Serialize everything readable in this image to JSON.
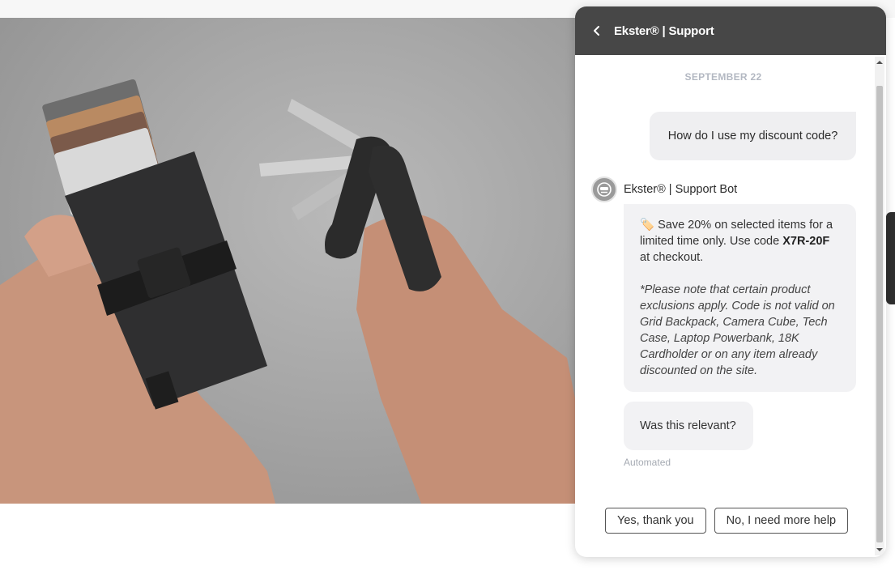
{
  "chat": {
    "title": "Ekster® | Support",
    "date": "SEPTEMBER 22",
    "user_message": "How do I use my discount code?",
    "bot_name": "Ekster® | Support Bot",
    "bot_message": {
      "emoji": "🏷️",
      "line_before_code": "Save 20% on selected items for a limited time only. Use code ",
      "code": "X7R-20F",
      "line_after_code": " at checkout.",
      "note": "*Please note that certain product exclusions apply. Code is not valid on Grid Backpack, Camera Cube, Tech Case, Laptop Powerbank, 18K Cardholder or on any item already discounted on the site."
    },
    "relevance_question": "Was this relevant?",
    "automated_label": "Automated",
    "quick_replies": {
      "yes": "Yes, thank you",
      "no": "No, I need more help"
    }
  },
  "icons": {
    "back": "chevron-left-icon",
    "bot_avatar": "robot-face-icon",
    "scroll_up": "scroll-up-arrow-icon",
    "scroll_down": "scroll-down-arrow-icon"
  },
  "colors": {
    "header_bg": "#474747",
    "bubble_bg": "#f2f2f4",
    "date_text": "#b3b8c2"
  }
}
